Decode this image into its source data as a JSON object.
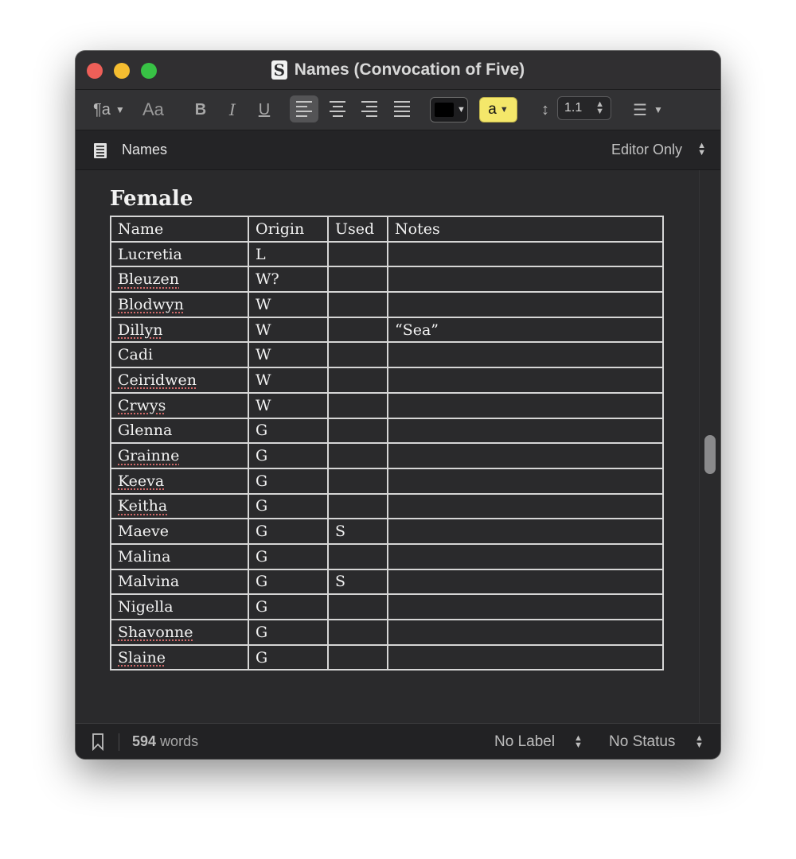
{
  "window": {
    "title": "Names (Convocation of Five)"
  },
  "format_bar": {
    "paragraph_style_icon": "¶a",
    "font_icon": "Aa",
    "bold_label": "B",
    "italic_label": "I",
    "underline_label": "U",
    "text_color": "#000000",
    "highlight_color": "#f4e76a",
    "highlight_label": "a",
    "line_spacing": "1.1",
    "active_alignment": "left"
  },
  "header": {
    "document_name": "Names",
    "view_mode": "Editor Only"
  },
  "editor": {
    "heading": "Female",
    "table": {
      "columns": [
        "Name",
        "Origin",
        "Used",
        "Notes"
      ],
      "rows": [
        [
          "Lucretia",
          "L",
          "",
          ""
        ],
        [
          "Bleuzen",
          "W?",
          "",
          ""
        ],
        [
          "Blodwyn",
          "W",
          "",
          ""
        ],
        [
          "Dillyn",
          "W",
          "",
          "“Sea”"
        ],
        [
          "Cadi",
          "W",
          "",
          ""
        ],
        [
          "Ceiridwen",
          "W",
          "",
          ""
        ],
        [
          "Crwys",
          "W",
          "",
          ""
        ],
        [
          "Glenna",
          "G",
          "",
          ""
        ],
        [
          "Grainne",
          "G",
          "",
          ""
        ],
        [
          "Keeva",
          "G",
          "",
          ""
        ],
        [
          "Keitha",
          "G",
          "",
          ""
        ],
        [
          "Maeve",
          "G",
          "S",
          ""
        ],
        [
          "Malina",
          "G",
          "",
          ""
        ],
        [
          "Malvina",
          "G",
          "S",
          ""
        ],
        [
          "Nigella",
          "G",
          "",
          ""
        ],
        [
          "Shavonne",
          "G",
          "",
          ""
        ],
        [
          "Slaine",
          "G",
          "",
          ""
        ]
      ]
    },
    "misspelled": [
      "Bleuzen",
      "Blodwyn",
      "Dillyn",
      "Ceiridwen",
      "Crwys",
      "Grainne",
      "Keeva",
      "Keitha",
      "Shavonne",
      "Slaine"
    ]
  },
  "footer": {
    "word_count": "594",
    "word_suffix": "words",
    "label": "No Label",
    "status": "No Status"
  }
}
